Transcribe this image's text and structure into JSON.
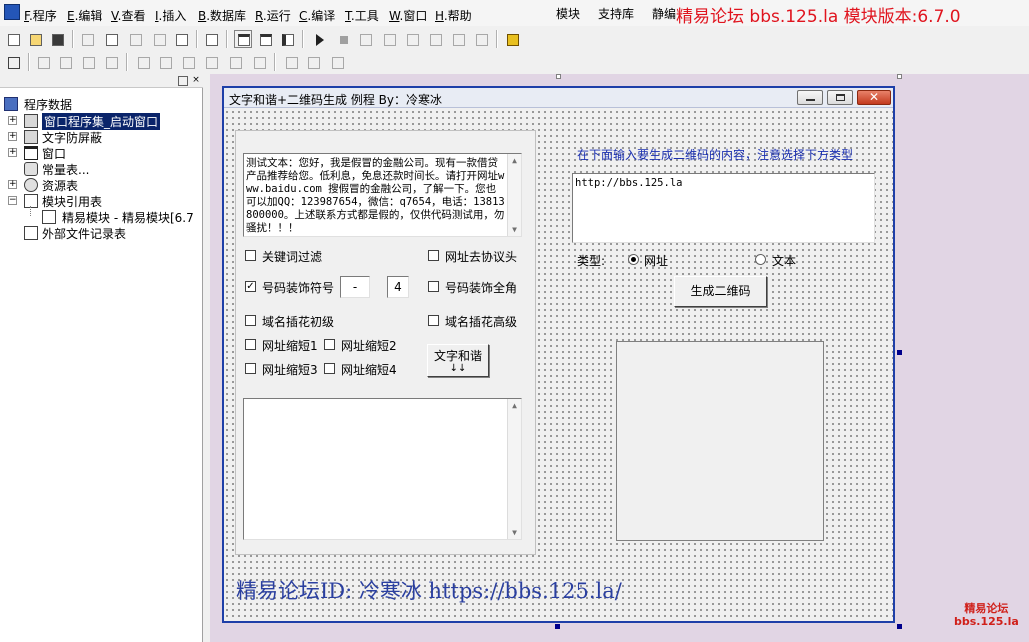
{
  "menubar": {
    "items": [
      {
        "key": "F",
        "label": ".程序"
      },
      {
        "key": "E",
        "label": ".编辑"
      },
      {
        "key": "V",
        "label": ".查看"
      },
      {
        "key": "I",
        "label": ".插入"
      },
      {
        "key": "B",
        "label": ".数据库"
      },
      {
        "key": "R",
        "label": ".运行"
      },
      {
        "key": "C",
        "label": ".编译"
      },
      {
        "key": "T",
        "label": ".工具"
      },
      {
        "key": "W",
        "label": ".窗口"
      },
      {
        "key": "H",
        "label": ".帮助"
      }
    ],
    "right_items": [
      "模块",
      "支持库",
      "静编"
    ],
    "watermark": "精易论坛 bbs.125.la 模块版本:6.7.0"
  },
  "tree": {
    "root": "程序数据",
    "items": [
      {
        "label": "窗口程序集_启动窗口",
        "selected": true
      },
      {
        "label": "文字防屏蔽"
      },
      {
        "label": "窗口"
      },
      {
        "label": "常量表..."
      },
      {
        "label": "资源表"
      },
      {
        "label": "模块引用表"
      },
      {
        "label": "精易模块 - 精易模块[6.7"
      },
      {
        "label": "外部文件记录表"
      }
    ]
  },
  "form": {
    "title": "文字和谐+二维码生成 例程 By：冷寒冰",
    "sample_text": "测试文本：您好，我是假冒的金融公司。现有一款借贷产品推荐给您。低利息，免息还款时间长。请打开网址www.baidu.com 搜假冒的金融公司，了解一下。您也可以加QQ：123987654，微信：q7654，电话：13813800000。上述联系方式都是假的，仅供代码测试用，勿骚扰！！！",
    "checkboxes": {
      "keyword_filter": {
        "label": "关键词过滤",
        "checked": false
      },
      "url_strip_protocol": {
        "label": "网址去协议头",
        "checked": false
      },
      "number_decorate": {
        "label": "号码装饰符号",
        "checked": true
      },
      "number_fullwidth": {
        "label": "号码装饰全角",
        "checked": false
      },
      "domain_basic": {
        "label": "域名插花初级",
        "checked": false
      },
      "domain_advanced": {
        "label": "域名插花高级",
        "checked": false
      },
      "shorten1": {
        "label": "网址缩短1",
        "checked": false
      },
      "shorten2": {
        "label": "网址缩短2",
        "checked": false
      },
      "shorten3": {
        "label": "网址缩短3",
        "checked": false
      },
      "shorten4": {
        "label": "网址缩短4",
        "checked": false
      }
    },
    "decorate_symbol": "-",
    "decorate_count": "4",
    "harmonize_button": "文字和谐",
    "harmonize_arrows": "↓↓",
    "qr_hint": "在下面输入要生成二维码的内容，注意选择下方类型",
    "qr_input": "http://bbs.125.la",
    "type_label": "类型:",
    "type_url": "网址",
    "type_text": "文本",
    "type_selected": "网址",
    "generate_button": "生成二维码",
    "footer": "精易论坛ID: 冷寒冰 https://bbs.125.la/"
  },
  "corner_logo": {
    "line1": "精易论坛",
    "line2": "bbs.125.la"
  }
}
